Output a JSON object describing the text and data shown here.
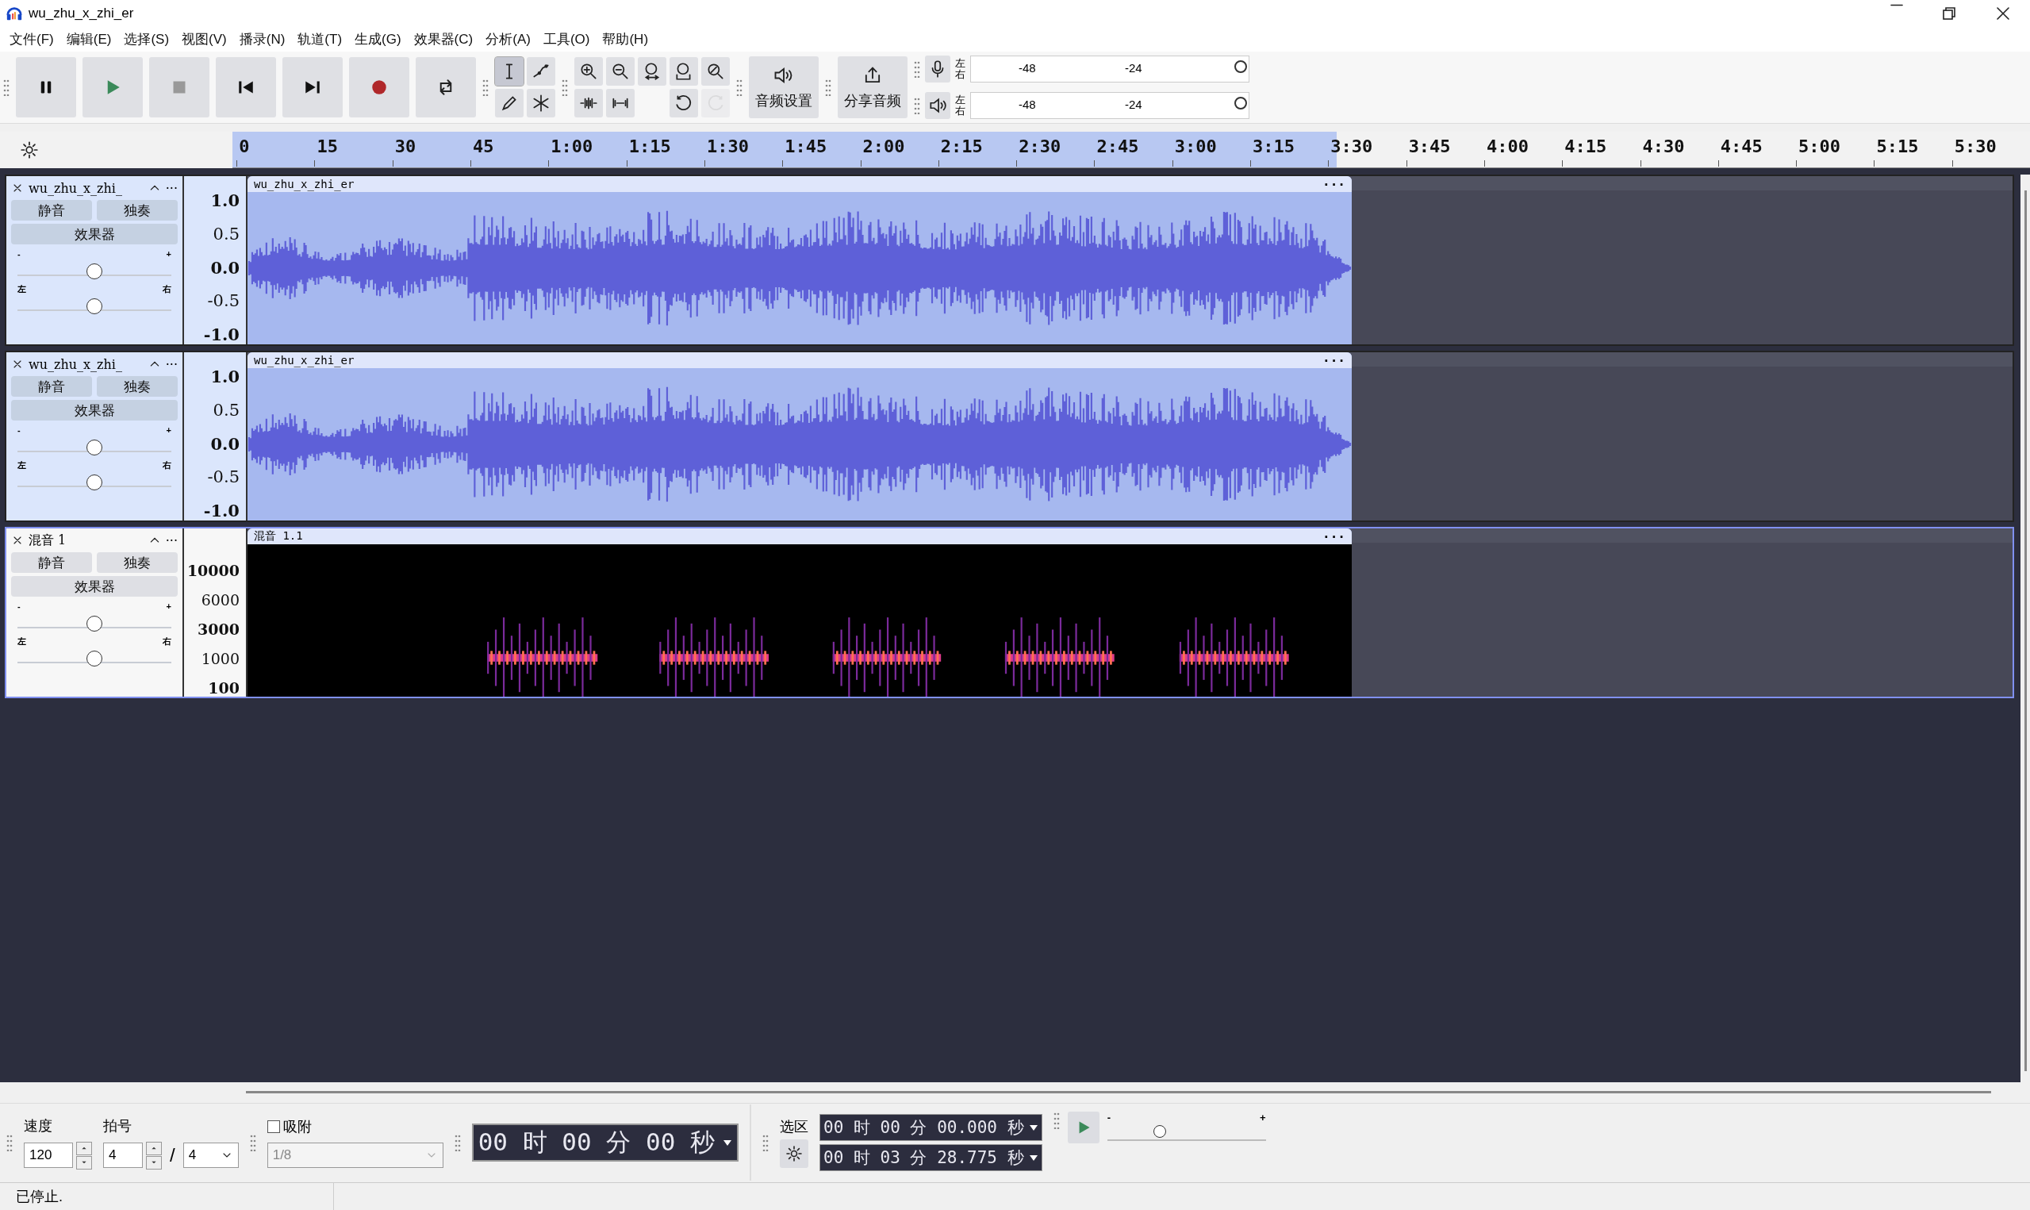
{
  "window": {
    "title": "wu_zhu_x_zhi_er"
  },
  "menu": [
    "文件(F)",
    "编辑(E)",
    "选择(S)",
    "视图(V)",
    "播录(N)",
    "轨道(T)",
    "生成(G)",
    "效果器(C)",
    "分析(A)",
    "工具(O)",
    "帮助(H)"
  ],
  "transport": [
    {
      "kind": "pause"
    },
    {
      "kind": "play"
    },
    {
      "kind": "stop"
    },
    {
      "kind": "skip-start"
    },
    {
      "kind": "skip-end"
    },
    {
      "kind": "record"
    },
    {
      "kind": "loop"
    }
  ],
  "tools": [
    {
      "kind": "select",
      "selected": true
    },
    {
      "kind": "envelope",
      "selected": false
    },
    {
      "kind": "draw",
      "selected": false
    },
    {
      "kind": "multi",
      "selected": false
    }
  ],
  "edit_tools": [
    {
      "kind": "zoom-in",
      "disabled": false
    },
    {
      "kind": "zoom-out",
      "disabled": false
    },
    {
      "kind": "fit-selection",
      "disabled": false
    },
    {
      "kind": "fit-project",
      "disabled": false
    },
    {
      "kind": "zoom-toggle",
      "disabled": false
    },
    {
      "kind": "trim",
      "disabled": false
    },
    {
      "kind": "silence",
      "disabled": false
    },
    {
      "kind": "undo",
      "disabled": false
    },
    {
      "kind": "redo",
      "disabled": true
    }
  ],
  "audio_setup": {
    "label": "音频设置"
  },
  "share": {
    "label": "分享音频"
  },
  "meters": [
    {
      "kind": "record",
      "left": "左",
      "right": "右",
      "ticks": [
        "-48",
        "-24"
      ]
    },
    {
      "kind": "playback",
      "left": "左",
      "right": "右",
      "ticks": [
        "-48",
        "-24"
      ]
    }
  ],
  "ruler": {
    "ticks": [
      "0",
      "15",
      "30",
      "45",
      "1:00",
      "1:15",
      "1:30",
      "1:45",
      "2:00",
      "2:15",
      "2:30",
      "2:45",
      "3:00",
      "3:15",
      "3:30",
      "3:45",
      "4:00",
      "4:15",
      "4:30",
      "4:45",
      "5:00",
      "5:15",
      "5:30"
    ]
  },
  "tracks": [
    {
      "kind": "wave",
      "name": "wu_zhu_x_zhi_",
      "menu": "···",
      "selected": true,
      "focused": false,
      "mute": "静音",
      "solo": "独奏",
      "effects": "效果器",
      "gain": {
        "min": "-",
        "max": "+",
        "level": 0.5
      },
      "pan": {
        "min": "左",
        "max": "右",
        "level": 0.5
      },
      "scale": [
        "1.0",
        "0.5",
        "0.0",
        "-0.5",
        "-1.0"
      ],
      "clip": {
        "name": "wu_zhu_x_zhi_er",
        "menu": "···"
      }
    },
    {
      "kind": "wave",
      "name": "wu_zhu_x_zhi_",
      "menu": "···",
      "selected": true,
      "focused": false,
      "mute": "静音",
      "solo": "独奏",
      "effects": "效果器",
      "gain": {
        "min": "-",
        "max": "+",
        "level": 0.5
      },
      "pan": {
        "min": "左",
        "max": "右",
        "level": 0.5
      },
      "scale": [
        "1.0",
        "0.5",
        "0.0",
        "-0.5",
        "-1.0"
      ],
      "clip": {
        "name": "wu_zhu_x_zhi_er",
        "menu": "···"
      }
    },
    {
      "kind": "spectrogram",
      "name": "混音 1",
      "menu": "···",
      "selected": false,
      "focused": true,
      "mute": "静音",
      "solo": "独奏",
      "effects": "效果器",
      "gain": {
        "min": "-",
        "max": "+",
        "level": 0.5
      },
      "pan": {
        "min": "左",
        "max": "右",
        "level": 0.5
      },
      "scale": [
        "10000",
        "6000",
        "3000",
        "1000",
        "100"
      ],
      "clip": {
        "name": "混音 1.1",
        "menu": "···"
      }
    }
  ],
  "bottom": {
    "tempo_label": "速度",
    "tempo": "120",
    "meter_label": "拍号",
    "beats": "4",
    "slash": "/",
    "unit": "4",
    "snap": {
      "label": "吸附",
      "checked": false
    },
    "snap_value": {
      "value": "1/8",
      "disabled": true
    },
    "time": "00 时 00 分 00 秒",
    "selection_label": "选区",
    "selection_start": "00 时 00 分 00.000 秒",
    "selection_end": "00 时 03 分 28.775 秒",
    "speed": {
      "min": "-",
      "max": "+",
      "level": 0.33
    }
  },
  "status": "已停止."
}
